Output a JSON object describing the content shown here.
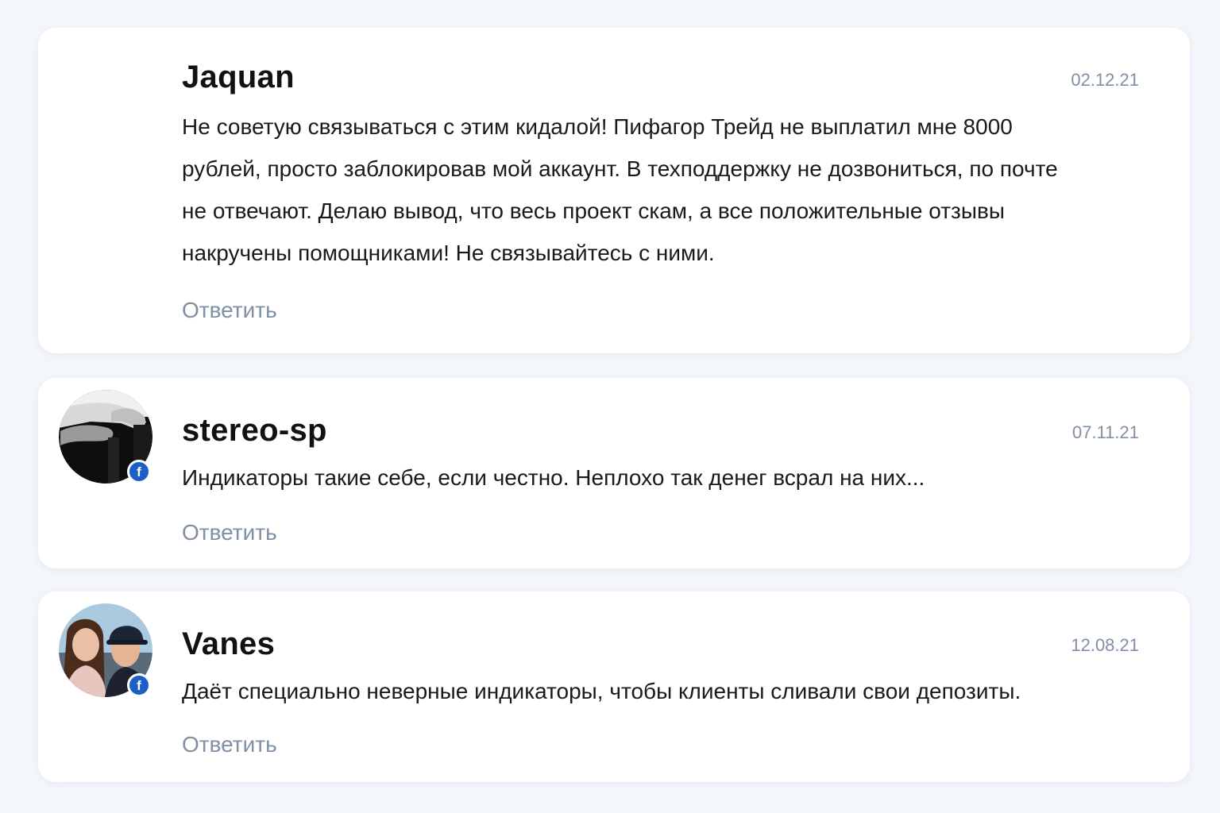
{
  "comments": [
    {
      "author": "Jaquan",
      "date": "02.12.21",
      "text": "Не советую связываться с этим кидалой! Пифагор Трейд не выплатил мне 8000 рублей, просто заблокировав мой аккаунт. В техподдержку не дозвониться, по почте не отвечают. Делаю вывод, что весь проект скам, а все положительные отзывы накручены помощниками! Не связывайтесь с ними.",
      "reply_label": "Ответить",
      "avatar": null
    },
    {
      "author": "stereo-sp",
      "date": "07.11.21",
      "text": "Индикаторы такие себе, если честно. Неплохо так денег всрал на них...",
      "reply_label": "Ответить",
      "avatar": {
        "icon": "user-photo-bw",
        "badge_icon": "facebook-icon",
        "badge_text": "f"
      }
    },
    {
      "author": "Vanes",
      "date": "12.08.21",
      "text": "Даёт специально неверные индикаторы, чтобы клиенты сливали свои депозиты.",
      "reply_label": "Ответить",
      "avatar": {
        "icon": "user-photo-couple",
        "badge_icon": "facebook-icon",
        "badge_text": "f"
      }
    }
  ],
  "colors": {
    "page_background": "#f3f6fa",
    "card_background": "#ffffff",
    "muted_text": "#7e8fa6",
    "facebook_badge": "#1b5fc7"
  }
}
